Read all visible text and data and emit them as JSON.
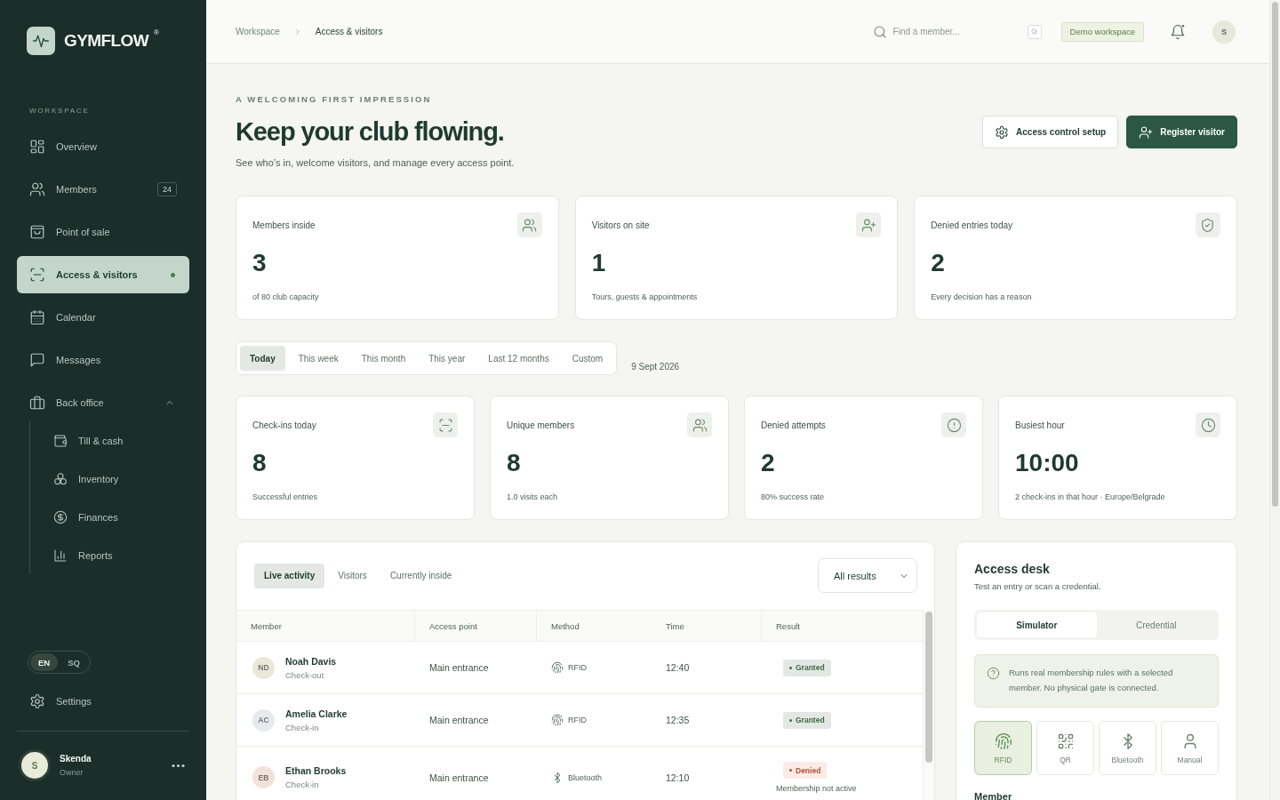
{
  "sidebar": {
    "brand": {
      "name": "GYMFLOW",
      "mark": "®"
    },
    "section_label": "WORKSPACE",
    "nav": [
      {
        "label": "Overview",
        "selected": false
      },
      {
        "label": "Members",
        "count": "24",
        "selected": false
      },
      {
        "label": "Point of sale",
        "selected": false
      },
      {
        "label": "Access & visitors",
        "selected": true
      },
      {
        "label": "Calendar",
        "selected": false
      },
      {
        "label": "Messages",
        "selected": false
      },
      {
        "label": "Back office",
        "selected": false,
        "expanded": true,
        "children": [
          {
            "label": "Till & cash",
            "selected": false
          },
          {
            "label": "Inventory",
            "selected": false
          },
          {
            "label": "Finances",
            "selected": false
          },
          {
            "label": "Reports",
            "selected": false
          }
        ]
      }
    ],
    "languages": [
      {
        "label": "EN",
        "selected": true
      },
      {
        "label": "SQ",
        "selected": false
      }
    ],
    "settings": "Settings",
    "user": {
      "initial": "S",
      "name": "Skenda",
      "role": "Owner"
    }
  },
  "topbar": {
    "breadcrumb": [
      "Workspace",
      "Access & visitors"
    ],
    "search": {
      "placeholder": "Find a member..."
    },
    "workspace_badge": "Demo workspace",
    "bell": {
      "unread": true
    },
    "avatar": "S"
  },
  "header": {
    "eyebrow": "A WELCOMING FIRST IMPRESSION",
    "title": "Keep your club flowing.",
    "subtitle": "See who’s in, welcome visitors, and manage every access point.",
    "actions": [
      {
        "label": "Access control setup",
        "kind": "secondary"
      },
      {
        "label": "Register visitor",
        "kind": "primary"
      }
    ]
  },
  "summary_cards": [
    {
      "label": "Members inside",
      "value": "3",
      "note": "of 80 club capacity"
    },
    {
      "label": "Visitors on site",
      "value": "1",
      "note": "Tours, guests & appointments"
    },
    {
      "label": "Denied entries today",
      "value": "2",
      "note": "Every decision has a reason"
    }
  ],
  "period": {
    "tabs": [
      {
        "label": "Today",
        "selected": true
      },
      {
        "label": "This week",
        "selected": false
      },
      {
        "label": "This month",
        "selected": false
      },
      {
        "label": "This year",
        "selected": false
      },
      {
        "label": "Last 12 months",
        "selected": false
      },
      {
        "label": "Custom",
        "selected": false
      }
    ],
    "date": "9 Sept 2026"
  },
  "stats": [
    {
      "label": "Check-ins today",
      "value": "8",
      "note": "Successful entries"
    },
    {
      "label": "Unique members",
      "value": "8",
      "note": "1.0 visits each"
    },
    {
      "label": "Denied attempts",
      "value": "2",
      "note": "80% success rate"
    },
    {
      "label": "Busiest hour",
      "value": "10:00",
      "note": "2 check-ins in that hour · Europe/Belgrade"
    }
  ],
  "activity": {
    "tabs": [
      {
        "label": "Live activity",
        "selected": true
      },
      {
        "label": "Visitors",
        "selected": false
      },
      {
        "label": "Currently inside",
        "selected": false
      }
    ],
    "filter": "All results",
    "columns": [
      "Member",
      "Access point",
      "Method",
      "Time",
      "Result"
    ],
    "rows": [
      {
        "initials": "ND",
        "color": "#e8e9d8",
        "name": "Noah Davis",
        "action": "Check-out",
        "access_point": "Main entrance",
        "method": {
          "label": "RFID",
          "kind": "rfid"
        },
        "time": "12:40",
        "result": {
          "label": "Granted",
          "kind": "granted"
        }
      },
      {
        "initials": "AC",
        "color": "#e4eaf0",
        "name": "Amelia Clarke",
        "action": "Check-in",
        "access_point": "Main entrance",
        "method": {
          "label": "RFID",
          "kind": "rfid"
        },
        "time": "12:35",
        "result": {
          "label": "Granted",
          "kind": "granted"
        }
      },
      {
        "initials": "EB",
        "color": "#f3e2d9",
        "name": "Ethan Brooks",
        "action": "Check-in",
        "access_point": "Main entrance",
        "method": {
          "label": "Bluetooth",
          "kind": "bluetooth"
        },
        "time": "12:10",
        "result": {
          "label": "Denied",
          "kind": "denied",
          "reason": "Membership not active"
        }
      }
    ]
  },
  "access_desk": {
    "title": "Access desk",
    "subtitle": "Test an entry or scan a credential.",
    "modes": [
      {
        "label": "Simulator",
        "selected": true
      },
      {
        "label": "Credential",
        "selected": false
      }
    ],
    "notice": "Runs real membership rules with a selected member. No physical gate is connected.",
    "methods": [
      {
        "label": "RFID",
        "kind": "rfid",
        "selected": true
      },
      {
        "label": "QR",
        "kind": "qr",
        "selected": false
      },
      {
        "label": "Bluetooth",
        "kind": "bluetooth",
        "selected": false
      },
      {
        "label": "Manual",
        "kind": "manual",
        "selected": false
      }
    ],
    "member_label": "Member"
  }
}
